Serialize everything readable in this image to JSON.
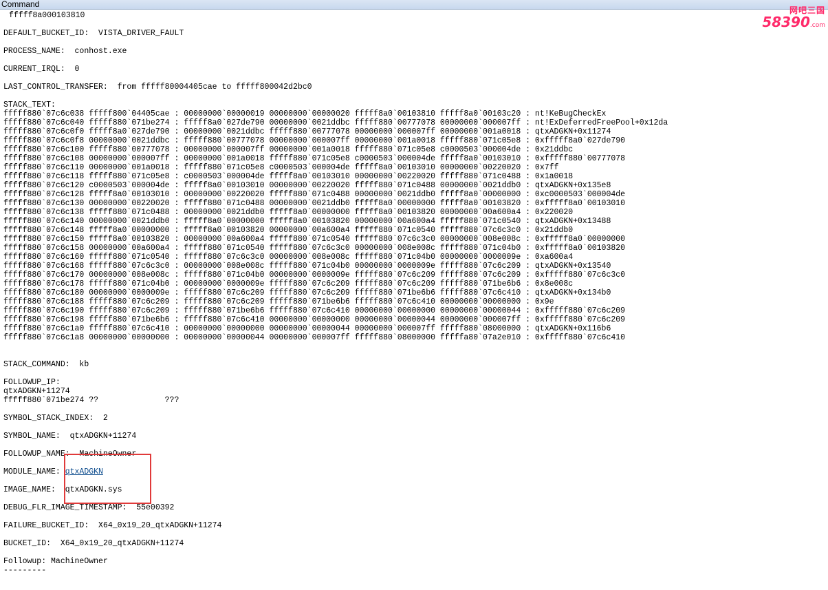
{
  "window": {
    "title": "Command"
  },
  "watermark": {
    "top": "网吧三国",
    "number": "58390",
    "suffix": ".com"
  },
  "header_line": "fffff8a000103810",
  "fields": {
    "default_bucket_id": "DEFAULT_BUCKET_ID:  VISTA_DRIVER_FAULT",
    "process_name": "PROCESS_NAME:  conhost.exe",
    "current_irql": "CURRENT_IRQL:  0",
    "last_control_transfer": "LAST_CONTROL_TRANSFER:  from fffff80004405cae to fffff800042d2bc0",
    "stack_text_label": "STACK_TEXT:",
    "stack_command": "STACK_COMMAND:  kb",
    "followup_ip_label": "FOLLOWUP_IP:",
    "followup_ip_symbol": "qtxADGKN+11274",
    "followup_ip_addr": "fffff880`071be274 ??              ???",
    "symbol_stack_index": "SYMBOL_STACK_INDEX:  2",
    "symbol_name": "SYMBOL_NAME:  qtxADGKN+11274",
    "followup_name": "FOLLOWUP_NAME:  MachineOwner",
    "module_name_label": "MODULE_NAME: ",
    "module_name_value": "qtxADGKN",
    "image_name": "IMAGE_NAME:  qtxADGKN.sys",
    "debug_flr_image_timestamp": "DEBUG_FLR_IMAGE_TIMESTAMP:  55e00392",
    "failure_bucket_id": "FAILURE_BUCKET_ID:  X64_0x19_20_qtxADGKN+11274",
    "bucket_id": "BUCKET_ID:  X64_0x19_20_qtxADGKN+11274",
    "followup": "Followup: MachineOwner",
    "separator": "---------"
  },
  "stack_rows": [
    "fffff880`07c6c038 fffff800`04405cae : 00000000`00000019 00000000`00000020 fffff8a0`00103810 fffff8a0`00103c20 : nt!KeBugCheckEx",
    "fffff880`07c6c040 fffff880`071be274 : fffff8a0`027de790 00000000`0021ddbc fffff880`00777078 00000000`000007ff : nt!ExDeferredFreePool+0x12da",
    "fffff880`07c6c0f0 fffff8a0`027de790 : 00000000`0021ddbc fffff880`00777078 00000000`000007ff 00000000`001a0018 : qtxADGKN+0x11274",
    "fffff880`07c6c0f8 00000000`0021ddbc : fffff880`00777078 00000000`000007ff 00000000`001a0018 fffff880`071c05e8 : 0xfffff8a0`027de790",
    "fffff880`07c6c100 fffff880`00777078 : 00000000`000007ff 00000000`001a0018 fffff880`071c05e8 c0000503`000004de : 0x21ddbc",
    "fffff880`07c6c108 00000000`000007ff : 00000000`001a0018 fffff880`071c05e8 c0000503`000004de fffff8a0`00103010 : 0xfffff880`00777078",
    "fffff880`07c6c110 00000000`001a0018 : fffff880`071c05e8 c0000503`000004de fffff8a0`00103010 00000000`00220020 : 0x7ff",
    "fffff880`07c6c118 fffff880`071c05e8 : c0000503`000004de fffff8a0`00103010 00000000`00220020 fffff880`071c0488 : 0x1a0018",
    "fffff880`07c6c120 c0000503`000004de : fffff8a0`00103010 00000000`00220020 fffff880`071c0488 00000000`0021ddb0 : qtxADGKN+0x135e8",
    "fffff880`07c6c128 fffff8a0`00103010 : 00000000`00220020 fffff880`071c0488 00000000`0021ddb0 fffff8a0`00000000 : 0xc0000503`000004de",
    "fffff880`07c6c130 00000000`00220020 : fffff880`071c0488 00000000`0021ddb0 fffff8a0`00000000 fffff8a0`00103820 : 0xfffff8a0`00103010",
    "fffff880`07c6c138 fffff880`071c0488 : 00000000`0021ddb0 fffff8a0`00000000 fffff8a0`00103820 00000000`00a600a4 : 0x220020",
    "fffff880`07c6c140 00000000`0021ddb0 : fffff8a0`00000000 fffff8a0`00103820 00000000`00a600a4 fffff880`071c0540 : qtxADGKN+0x13488",
    "fffff880`07c6c148 fffff8a0`00000000 : fffff8a0`00103820 00000000`00a600a4 fffff880`071c0540 fffff880`07c6c3c0 : 0x21ddb0",
    "fffff880`07c6c150 fffff8a0`00103820 : 00000000`00a600a4 fffff880`071c0540 fffff880`07c6c3c0 00000000`008e008c : 0xfffff8a0`00000000",
    "fffff880`07c6c158 00000000`00a600a4 : fffff880`071c0540 fffff880`07c6c3c0 00000000`008e008c fffff880`071c04b0 : 0xfffff8a0`00103820",
    "fffff880`07c6c160 fffff880`071c0540 : fffff880`07c6c3c0 00000000`008e008c fffff880`071c04b0 00000000`0000009e : 0xa600a4",
    "fffff880`07c6c168 fffff880`07c6c3c0 : 00000000`008e008c fffff880`071c04b0 00000000`0000009e fffff880`07c6c209 : qtxADGKN+0x13540",
    "fffff880`07c6c170 00000000`008e008c : fffff880`071c04b0 00000000`0000009e fffff880`07c6c209 fffff880`07c6c209 : 0xfffff880`07c6c3c0",
    "fffff880`07c6c178 fffff880`071c04b0 : 00000000`0000009e fffff880`07c6c209 fffff880`07c6c209 fffff880`071be6b6 : 0x8e008c",
    "fffff880`07c6c180 00000000`0000009e : fffff880`07c6c209 fffff880`07c6c209 fffff880`071be6b6 fffff880`07c6c410 : qtxADGKN+0x134b0",
    "fffff880`07c6c188 fffff880`07c6c209 : fffff880`07c6c209 fffff880`071be6b6 fffff880`07c6c410 00000000`00000000 : 0x9e",
    "fffff880`07c6c190 fffff880`07c6c209 : fffff880`071be6b6 fffff880`07c6c410 00000000`00000000 00000000`00000044 : 0xfffff880`07c6c209",
    "fffff880`07c6c198 fffff880`071be6b6 : fffff880`07c6c410 00000000`00000000 00000000`00000044 00000000`000007ff : 0xfffff880`07c6c209",
    "fffff880`07c6c1a0 fffff880`07c6c410 : 00000000`00000000 00000000`00000044 00000000`000007ff fffff880`08000000 : qtxADGKN+0x116b6",
    "fffff880`07c6c1a8 00000000`00000000 : 00000000`00000044 00000000`000007ff fffff880`08000000 fffffa80`07a2e010 : 0xfffff880`07c6c410"
  ]
}
